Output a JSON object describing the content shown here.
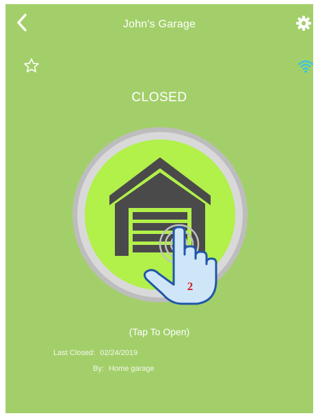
{
  "header": {
    "title": "John's Garage",
    "back_icon": "chevron-left-icon",
    "settings_icon": "gear-icon"
  },
  "toolbar": {
    "favorite_icon": "star-outline-icon",
    "connection_icon": "wifi-icon"
  },
  "door": {
    "status": "CLOSED",
    "action_hint": "(Tap To Open)",
    "icon": "garage-door-icon",
    "overlay_icon": "tap-hand-icon",
    "step_number": "2"
  },
  "details": {
    "last_closed_label": "Last Closed:",
    "last_closed_value": "02/24/2019",
    "by_label": "By:",
    "by_value": "Home garage"
  },
  "colors": {
    "background": "#a3cf6a",
    "button_fill": "#b2f04a",
    "ring": "#c8c8c8",
    "icon_dark": "#4a4a4a",
    "wifi": "#2fc4e8",
    "hand_fill": "#cfe6f8",
    "hand_outline": "#1f56a8",
    "step_number_color": "#d0201c"
  }
}
